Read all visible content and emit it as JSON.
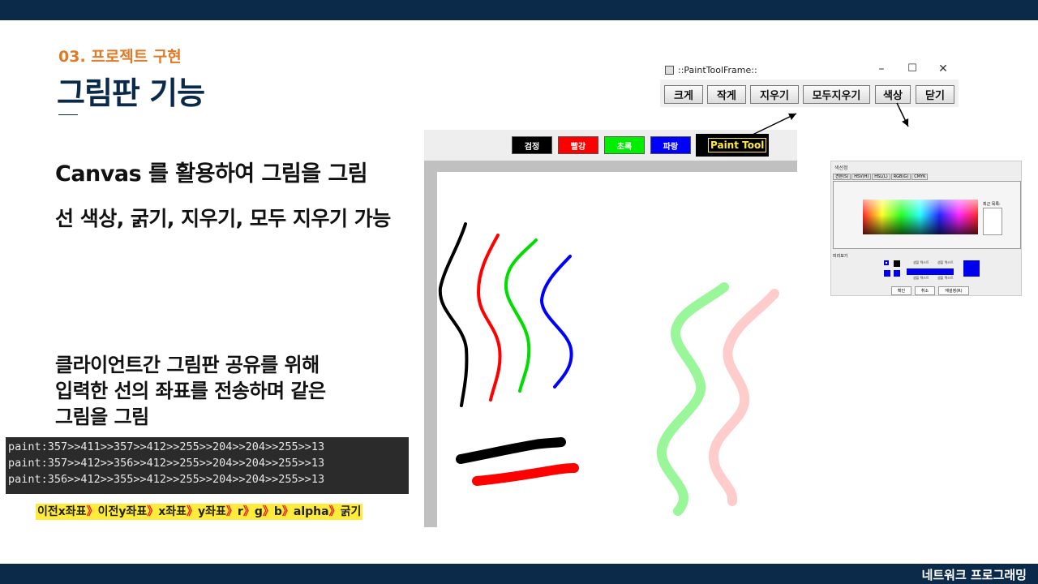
{
  "slide": {
    "section": "03. 프로젝트 구현",
    "title": "그림판 기능",
    "desc_line1": "Canvas 를 활용하여 그림을 그림",
    "desc_line2": "선 색상, 굵기, 지우기, 모두 지우기 가능",
    "desc2_line1": "클라이언트간 그림판 공유를 위해",
    "desc2_line2": "입력한 선의 좌표를 전송하며 같은",
    "desc2_line3": "그림을 그림",
    "footer": "네트워크 프로그래밍"
  },
  "console_lines": [
    "paint:357>>411>>357>>412>>255>>204>>204>>255>>13",
    "paint:357>>412>>356>>412>>255>>204>>204>>255>>13",
    "paint:356>>412>>355>>412>>255>>204>>204>>255>>13"
  ],
  "legend": {
    "parts": [
      "이전x좌표",
      "이전y좌표",
      "x좌표",
      "y좌표",
      "r",
      "g",
      "b",
      "alpha",
      "굵기"
    ],
    "separator": "》"
  },
  "frame": {
    "title": "::PaintToolFrame::",
    "minimize": "–",
    "maximize": "☐",
    "close": "✕",
    "buttons": [
      "크게",
      "작게",
      "지우기",
      "모두지우기",
      "색상",
      "닫기"
    ]
  },
  "panel": {
    "color_buttons": [
      {
        "label": "검정",
        "color": "#000000"
      },
      {
        "label": "빨강",
        "color": "#ff0000"
      },
      {
        "label": "초록",
        "color": "#00ee00"
      },
      {
        "label": "파랑",
        "color": "#0000ff"
      }
    ],
    "paint_label": "Paint Tool"
  },
  "chooser": {
    "title": "색선정",
    "tabs": [
      "견본(S)",
      "HSV(H)",
      "HSL(L)",
      "RGB(G)",
      "CMYK"
    ],
    "recent_label": "최근 목록:",
    "preview_label": "미리보기",
    "sample_text": "샘플 텍스트",
    "buttons": [
      "확인",
      "취소",
      "재설정(R)"
    ]
  },
  "colors": {
    "navy": "#0b2a4a",
    "orange": "#e07a26",
    "highlight": "#ffeb3b"
  }
}
